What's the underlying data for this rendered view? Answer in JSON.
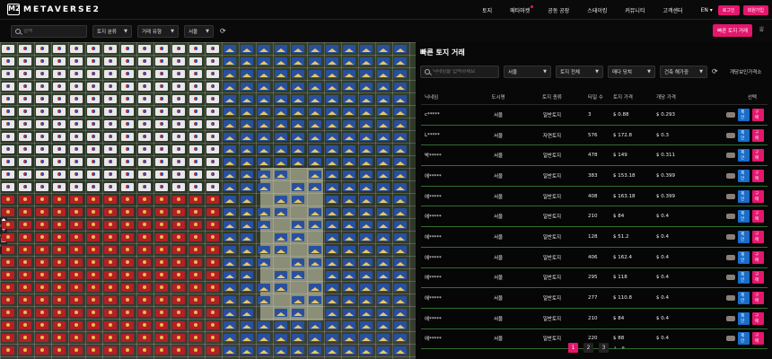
{
  "brand": {
    "logo_mark": "M2",
    "name": "METAVERSE2"
  },
  "nav": {
    "items": [
      "토지",
      "메타마켓",
      "공동 공장",
      "스테이킹",
      "커뮤니티",
      "고객센터"
    ],
    "lang": "EN",
    "login": "로그인",
    "signup": "회원가입"
  },
  "toolbar": {
    "search_placeholder": "검색",
    "filter1": "토지 분류",
    "filter2": "거래 유형",
    "filter3": "서울",
    "quick_button": "빠른 토지 거래"
  },
  "panel": {
    "title": "빠른 토지 거래",
    "search_placeholder": "닉네임을 입력하세요",
    "region": "서울",
    "land_all": "토지 전체",
    "trade_type": "매다 당쳐",
    "price_order": "건축 해가중",
    "option_text": "개당보인가격소",
    "headers": [
      "닉네임",
      "도시명",
      "토지 종류",
      "타일 수",
      "토지 가격",
      "개당 가격",
      "선택"
    ],
    "rows": [
      {
        "nick": "c*****",
        "city": "서울",
        "type": "일반토지",
        "tiles": "3",
        "price": "$ 0.88",
        "unit": "$ 0.293"
      },
      {
        "nick": "L*****",
        "city": "서울",
        "type": "자연토지",
        "tiles": "576",
        "price": "$ 172.8",
        "unit": "$ 0.3"
      },
      {
        "nick": "박*****",
        "city": "서울",
        "type": "일반토지",
        "tiles": "478",
        "price": "$ 149",
        "unit": "$ 0.311"
      },
      {
        "nick": "에*****",
        "city": "서울",
        "type": "일반토지",
        "tiles": "383",
        "price": "$ 153.18",
        "unit": "$ 0.399"
      },
      {
        "nick": "에*****",
        "city": "서울",
        "type": "일반토지",
        "tiles": "408",
        "price": "$ 163.18",
        "unit": "$ 0.399"
      },
      {
        "nick": "에*****",
        "city": "서울",
        "type": "일반토지",
        "tiles": "210",
        "price": "$ 84",
        "unit": "$ 0.4"
      },
      {
        "nick": "에*****",
        "city": "서울",
        "type": "일반토지",
        "tiles": "128",
        "price": "$ 51.2",
        "unit": "$ 0.4"
      },
      {
        "nick": "에*****",
        "city": "서울",
        "type": "일반토지",
        "tiles": "406",
        "price": "$ 162.4",
        "unit": "$ 0.4"
      },
      {
        "nick": "에*****",
        "city": "서울",
        "type": "일반토지",
        "tiles": "295",
        "price": "$ 118",
        "unit": "$ 0.4"
      },
      {
        "nick": "에*****",
        "city": "서울",
        "type": "일반토지",
        "tiles": "277",
        "price": "$ 110.8",
        "unit": "$ 0.4"
      },
      {
        "nick": "에*****",
        "city": "서울",
        "type": "일반토지",
        "tiles": "210",
        "price": "$ 84",
        "unit": "$ 0.4"
      },
      {
        "nick": "에*****",
        "city": "서울",
        "type": "일반토지",
        "tiles": "220",
        "price": "$ 88",
        "unit": "$ 0.4"
      }
    ],
    "action_offer": "제안",
    "action_buy": "구매",
    "pages": [
      "1",
      "2",
      "3"
    ],
    "current_page": "1"
  },
  "colors": {
    "accent": "#e4166d",
    "offer_blue": "#1a6cc9",
    "row_border": "#2f6f2f"
  }
}
